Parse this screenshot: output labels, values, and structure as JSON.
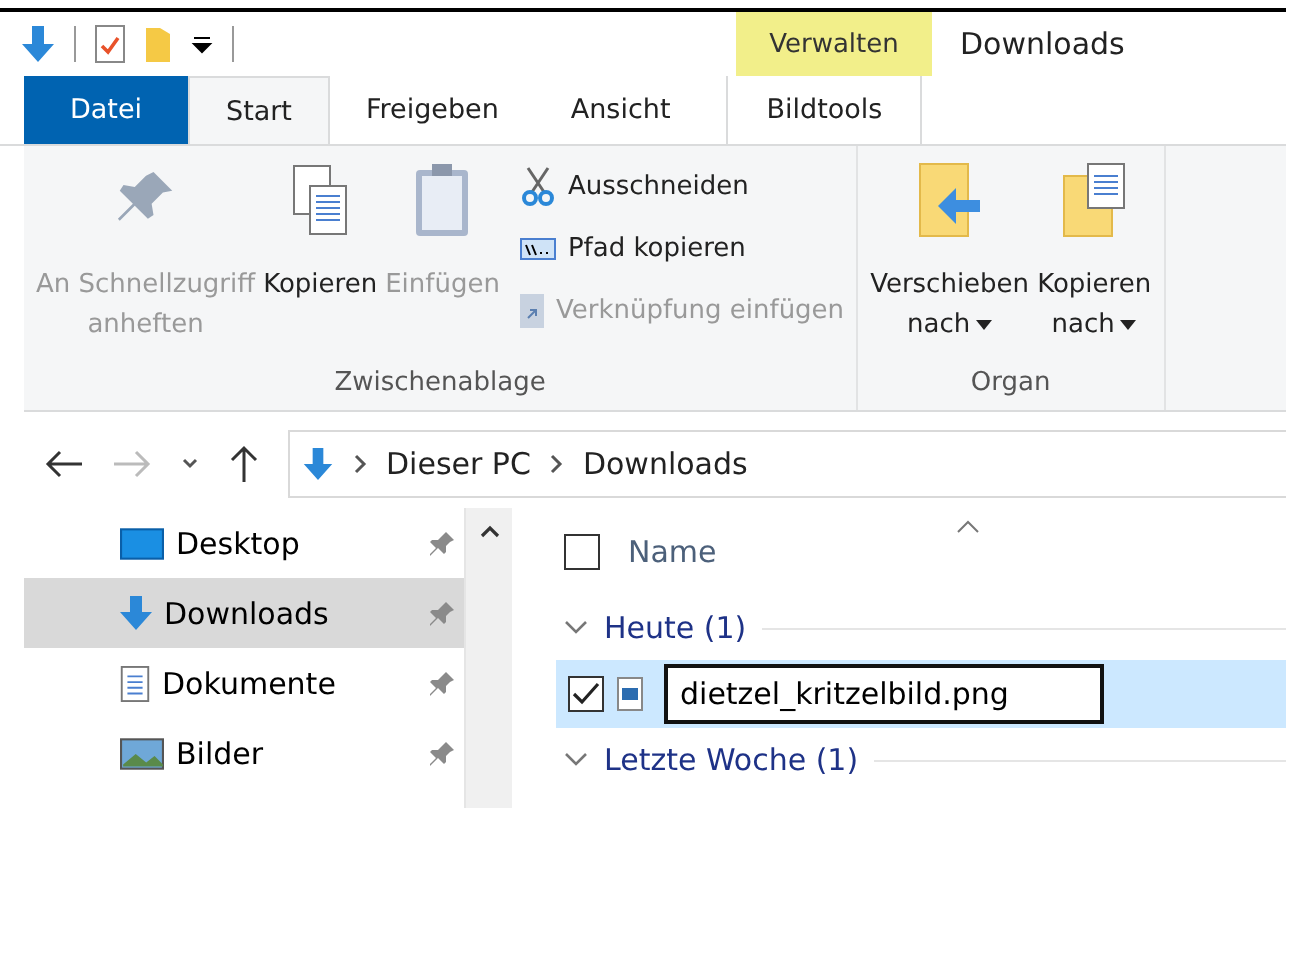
{
  "title_bar": {
    "context_tab": "Verwalten",
    "title": "Downloads"
  },
  "tabs": [
    {
      "label": "Datei",
      "kind": "file",
      "selected": false
    },
    {
      "label": "Start",
      "kind": "tab",
      "selected": true
    },
    {
      "label": "Freigeben",
      "kind": "tab",
      "selected": false
    },
    {
      "label": "Ansicht",
      "kind": "tab",
      "selected": false
    },
    {
      "label": "Bildtools",
      "kind": "context",
      "selected": false
    }
  ],
  "ribbon": {
    "groups": [
      {
        "label": "Zwischenablage",
        "large": [
          {
            "label": "An Schnellzugriff\nanheften",
            "disabled": true
          },
          {
            "label": "Kopieren",
            "disabled": false
          },
          {
            "label": "Einfügen",
            "disabled": true
          }
        ],
        "small": [
          {
            "label": "Ausschneiden",
            "disabled": false
          },
          {
            "label": "Pfad kopieren",
            "disabled": false
          },
          {
            "label": "Verknüpfung einfügen",
            "disabled": true
          }
        ]
      },
      {
        "label": "Organ",
        "large": [
          {
            "label": "Verschieben\nnach",
            "disabled": false,
            "dropdown": true
          },
          {
            "label": "Kopieren\nnach",
            "disabled": false,
            "dropdown": true
          }
        ]
      }
    ]
  },
  "address": {
    "path": [
      "Dieser PC",
      "Downloads"
    ]
  },
  "sidebar": {
    "items": [
      {
        "label": "Desktop",
        "selected": false
      },
      {
        "label": "Downloads",
        "selected": true
      },
      {
        "label": "Dokumente",
        "selected": false
      },
      {
        "label": "Bilder",
        "selected": false
      }
    ]
  },
  "file_list": {
    "column": "Name",
    "select_all_checked": false,
    "groups": [
      {
        "label": "Heute (1)",
        "files": [
          {
            "name": "dietzel_kritzelbild.png",
            "checked": true,
            "selected": true,
            "renaming": true
          }
        ]
      },
      {
        "label": "Letzte Woche (1)"
      }
    ]
  }
}
